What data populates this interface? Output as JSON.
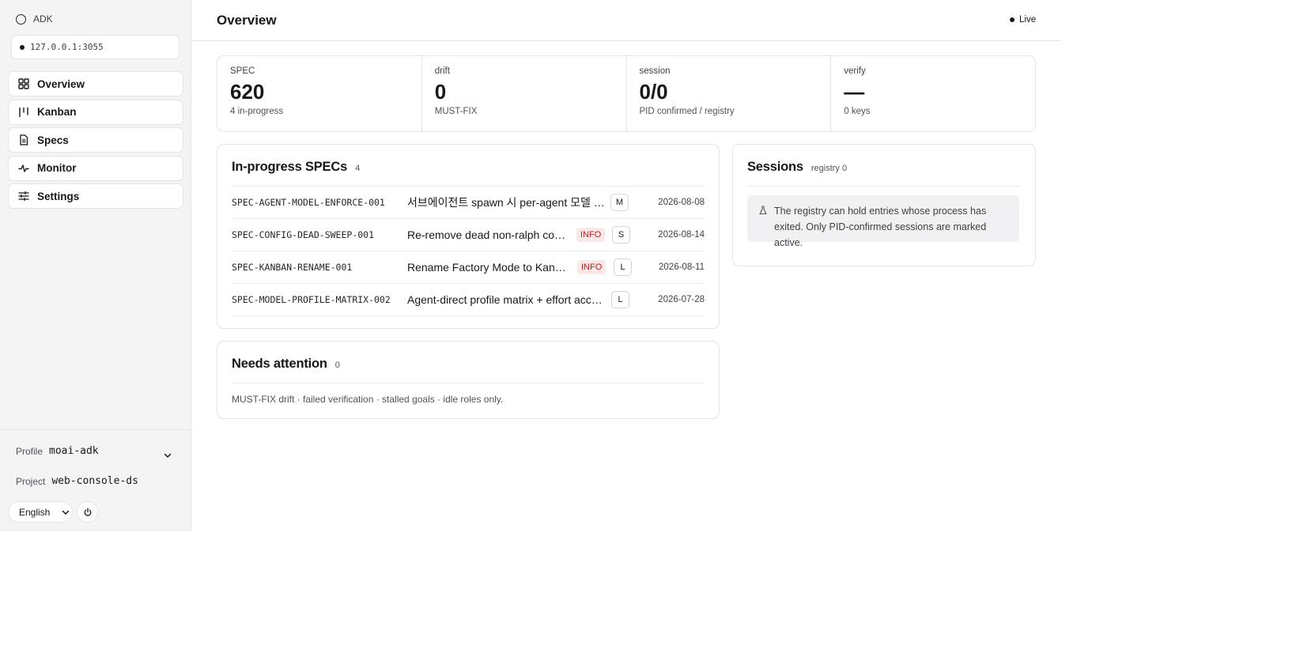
{
  "brand": {
    "name": "ADK"
  },
  "server": {
    "address": "127.0.0.1:3055"
  },
  "nav": {
    "items": [
      {
        "label": "Overview",
        "icon": "grid-icon"
      },
      {
        "label": "Kanban",
        "icon": "kanban-icon"
      },
      {
        "label": "Specs",
        "icon": "document-icon"
      },
      {
        "label": "Monitor",
        "icon": "pulse-icon"
      },
      {
        "label": "Settings",
        "icon": "sliders-icon"
      }
    ]
  },
  "sidebar_footer": {
    "profile_label": "Profile",
    "profile_value": "moai-adk",
    "project_label": "Project",
    "project_value": "web-console-ds",
    "language": "English"
  },
  "header": {
    "title": "Overview",
    "status": "Live"
  },
  "stats": [
    {
      "label": "SPEC",
      "value": "620",
      "sub": "4 in-progress"
    },
    {
      "label": "drift",
      "value": "0",
      "sub": "MUST-FIX"
    },
    {
      "label": "session",
      "value": "0/0",
      "sub": "PID confirmed / registry"
    },
    {
      "label": "verify",
      "value": "—",
      "sub": "0 keys"
    }
  ],
  "in_progress": {
    "title": "In-progress SPECs",
    "count": "4",
    "rows": [
      {
        "id": "SPEC-AGENT-MODEL-ENFORCE-001",
        "title": "서브에이전트 spawn 시 per-agent 모델 강제",
        "badge": "",
        "size": "M",
        "date": "2026-08-08"
      },
      {
        "id": "SPEC-CONFIG-DEAD-SWEEP-001",
        "title": "Re-remove dead non-ralph config",
        "badge": "INFO",
        "size": "S",
        "date": "2026-08-14"
      },
      {
        "id": "SPEC-KANBAN-RENAME-001",
        "title": "Rename Factory Mode to Kanban",
        "badge": "INFO",
        "size": "L",
        "date": "2026-08-11"
      },
      {
        "id": "SPEC-MODEL-PROFILE-MATRIX-002",
        "title": "Agent-direct profile matrix + effort accounting",
        "badge": "",
        "size": "L",
        "date": "2026-07-28"
      }
    ]
  },
  "sessions": {
    "title": "Sessions",
    "count": "registry 0",
    "note": "The registry can hold entries whose process has exited. Only PID-confirmed sessions are marked active."
  },
  "attention": {
    "title": "Needs attention",
    "count": "0",
    "text": "MUST-FIX drift · failed verification · stalled goals · idle roles only."
  }
}
